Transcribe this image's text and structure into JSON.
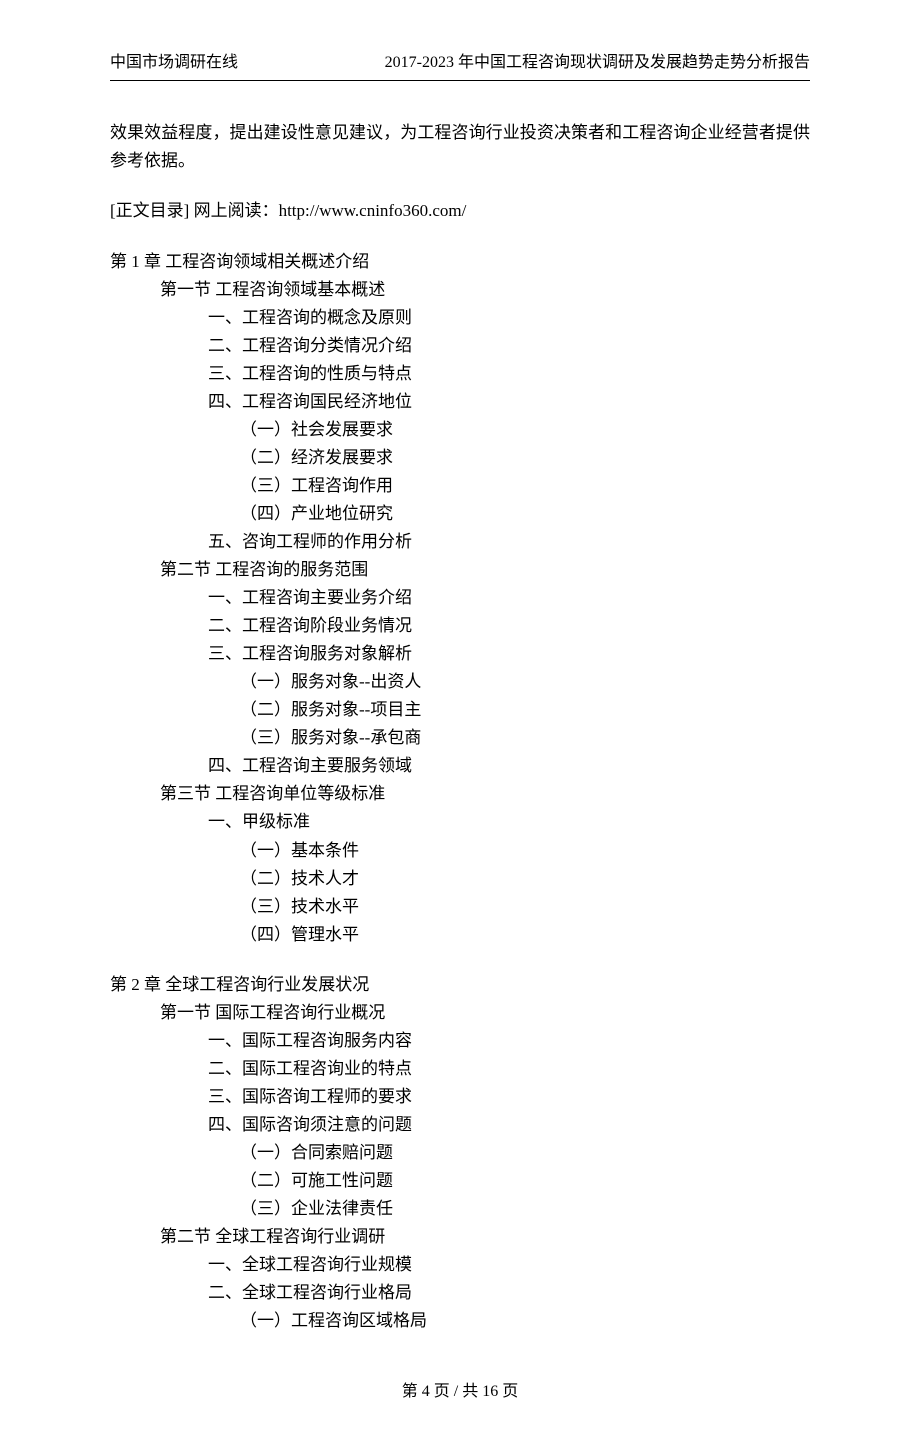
{
  "header": {
    "left": "中国市场调研在线",
    "right": "2017-2023 年中国工程咨询现状调研及发展趋势走势分析报告"
  },
  "intro": "效果效益程度，提出建设性意见建议，为工程咨询行业投资决策者和工程咨询企业经营者提供参考依据。",
  "tocNote": "[正文目录] 网上阅读：http://www.cninfo360.com/",
  "chapters": [
    {
      "title": "第 1 章   工程咨询领域相关概述介绍",
      "sections": [
        {
          "title": "第一节 工程咨询领域基本概述",
          "items": [
            {
              "text": "一、工程咨询的概念及原则",
              "subs": []
            },
            {
              "text": "二、工程咨询分类情况介绍",
              "subs": []
            },
            {
              "text": "三、工程咨询的性质与特点",
              "subs": []
            },
            {
              "text": "四、工程咨询国民经济地位",
              "subs": [
                "（一）社会发展要求",
                "（二）经济发展要求",
                "（三）工程咨询作用",
                "（四）产业地位研究"
              ]
            },
            {
              "text": "五、咨询工程师的作用分析",
              "subs": []
            }
          ]
        },
        {
          "title": "第二节 工程咨询的服务范围",
          "items": [
            {
              "text": "一、工程咨询主要业务介绍",
              "subs": []
            },
            {
              "text": "二、工程咨询阶段业务情况",
              "subs": []
            },
            {
              "text": "三、工程咨询服务对象解析",
              "subs": [
                "（一）服务对象--出资人",
                "（二）服务对象--项目主",
                "（三）服务对象--承包商"
              ]
            },
            {
              "text": "四、工程咨询主要服务领域",
              "subs": []
            }
          ]
        },
        {
          "title": "第三节 工程咨询单位等级标准",
          "items": [
            {
              "text": "一、甲级标准",
              "subs": [
                "（一）基本条件",
                "（二）技术人才",
                "（三）技术水平",
                "（四）管理水平"
              ]
            }
          ]
        }
      ]
    },
    {
      "title": "第 2 章    全球工程咨询行业发展状况",
      "sections": [
        {
          "title": "第一节 国际工程咨询行业概况",
          "items": [
            {
              "text": "一、国际工程咨询服务内容",
              "subs": []
            },
            {
              "text": "二、国际工程咨询业的特点",
              "subs": []
            },
            {
              "text": "三、国际咨询工程师的要求",
              "subs": []
            },
            {
              "text": "四、国际咨询须注意的问题",
              "subs": [
                "（一）合同索赔问题",
                "（二）可施工性问题",
                "（三）企业法律责任"
              ]
            }
          ]
        },
        {
          "title": "第二节 全球工程咨询行业调研",
          "items": [
            {
              "text": "一、全球工程咨询行业规模",
              "subs": []
            },
            {
              "text": "二、全球工程咨询行业格局",
              "subs": [
                "（一）工程咨询区域格局"
              ]
            }
          ]
        }
      ]
    }
  ],
  "footer": "第 4 页 / 共 16 页"
}
